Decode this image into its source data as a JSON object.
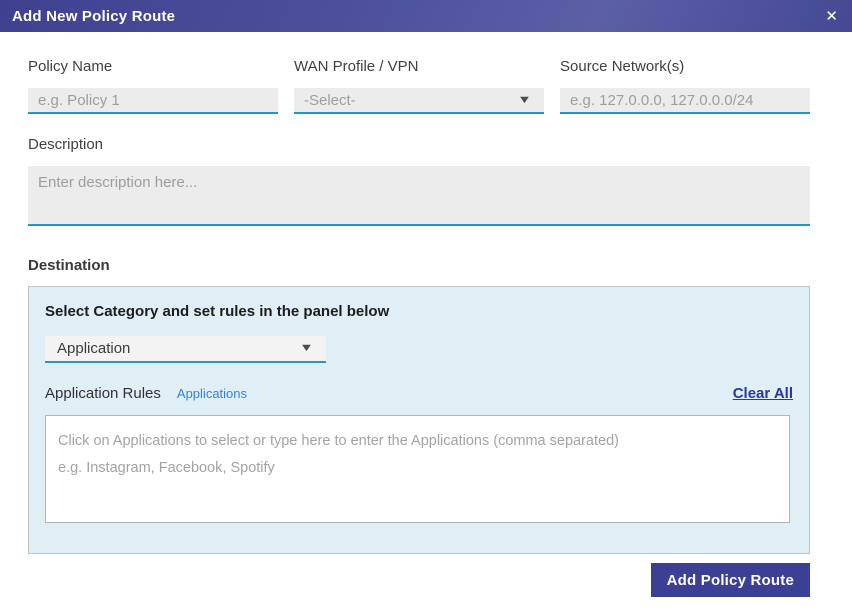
{
  "modal": {
    "title": "Add New Policy Route",
    "close_icon": "✕"
  },
  "fields": {
    "policy_name": {
      "label": "Policy Name",
      "placeholder": "e.g. Policy 1"
    },
    "wan_profile": {
      "label": "WAN Profile / VPN",
      "selected_value": "-Select-"
    },
    "source_networks": {
      "label": "Source Network(s)",
      "placeholder": "e.g. 127.0.0.0, 127.0.0.0/24"
    },
    "description": {
      "label": "Description",
      "placeholder": "Enter description here..."
    }
  },
  "destination": {
    "section_label": "Destination",
    "instruction": "Select Category and set rules in the panel below",
    "category_selected_value": "Application",
    "rules_label": "Application Rules",
    "applications_link_label": "Applications",
    "clear_all_label": "Clear All",
    "rules_placeholder_line1": "Click on Applications to select or type here to enter the Applications (comma separated)",
    "rules_placeholder_line2": "e.g. Instagram, Facebook, Spotify"
  },
  "footer": {
    "submit_label": "Add Policy Route"
  },
  "icons": {
    "dropdown_caret": "▼"
  },
  "colors": {
    "header_indigo": "#454994",
    "input_underline_teal": "#2794c3",
    "panel_blue": "#e0eef5",
    "link_blue": "#2e86e0",
    "clear_all_navy": "#2b389b",
    "button_indigo": "#3b4094"
  }
}
